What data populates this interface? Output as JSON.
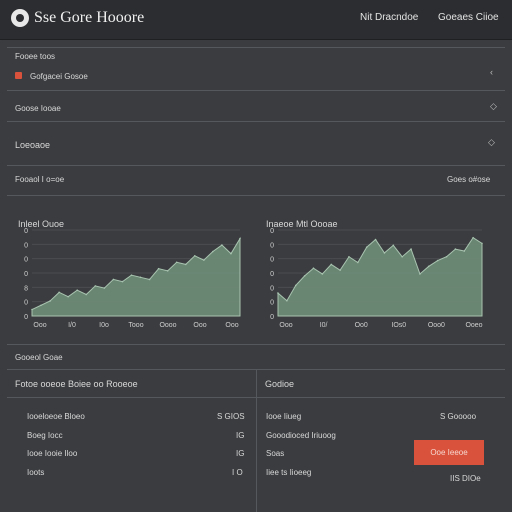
{
  "header": {
    "app_title": "Sse Gore Hooore",
    "nav": [
      "Nit Dracndoe",
      "Goeaes Ciioe"
    ]
  },
  "sidebar": {
    "title": "Fooee toos",
    "items": [
      {
        "label": "Gofgacei Gosoe"
      },
      {
        "label": "Goose Iooae"
      }
    ]
  },
  "section_title": "Loeoaoe",
  "overview": {
    "label": "Fooaol I o=oe",
    "right_label": "Goes o#ose"
  },
  "chart_data": [
    {
      "type": "area",
      "title": "Inleel Ouoe",
      "y_ticks": [
        "0",
        "0",
        "0",
        "0",
        "8",
        "0",
        "0"
      ],
      "x_tick_labels": [
        "Ooo",
        "I/0",
        "I0o",
        "Tooo",
        "Oooo",
        "Ooo",
        "Ooo"
      ],
      "values": [
        3,
        5,
        7,
        11,
        9,
        12,
        10,
        14,
        13,
        17,
        16,
        19,
        18,
        17,
        22,
        21,
        25,
        24,
        28,
        26,
        30,
        33,
        29,
        36
      ],
      "ylim": [
        0,
        40
      ],
      "color": "#6f8e79"
    },
    {
      "type": "area",
      "title": "Inaeoe Mtl Oooae",
      "y_ticks": [
        "0",
        "0",
        "0",
        "0",
        "0",
        "0",
        "0"
      ],
      "x_tick_labels": [
        "Ooo",
        "I0/",
        "Oo0",
        "IOs0",
        "Ooo0",
        "Ooeo"
      ],
      "values": [
        12,
        8,
        16,
        21,
        25,
        22,
        27,
        24,
        31,
        28,
        36,
        40,
        33,
        37,
        31,
        35,
        22,
        26,
        29,
        31,
        35,
        34,
        41,
        38
      ],
      "ylim": [
        0,
        45
      ],
      "color": "#6f8e79"
    }
  ],
  "details": {
    "section_label": "Gooeol Goae",
    "left_title": "Fotoe ooeoe Boiee oo Rooeoe",
    "right_title": "Godioe",
    "left_rows": [
      {
        "label": "Iooeloeoe Bloeo",
        "value": "S GIOS"
      },
      {
        "label": "Boeg Iocc",
        "value": "IG"
      },
      {
        "label": "Iooe Iooie Iloo",
        "value": "IG"
      },
      {
        "label": "Ioots",
        "value": "I O"
      }
    ],
    "right_rows": [
      {
        "label": "Iooe Iiueg",
        "value": "S Gooooo"
      },
      {
        "label": "Gooodioced Iriuoog",
        "value": ""
      },
      {
        "label": "Soas",
        "value": ""
      },
      {
        "label": "Iiee ts Iioeeg",
        "value": "IIS DIOe"
      }
    ],
    "action_button": "Ooe Ieeoe"
  },
  "colors": {
    "accent": "#d9533c",
    "chart_fill": "#6f8e79",
    "background": "#3a3c3f",
    "topbar": "#2b2d30"
  }
}
